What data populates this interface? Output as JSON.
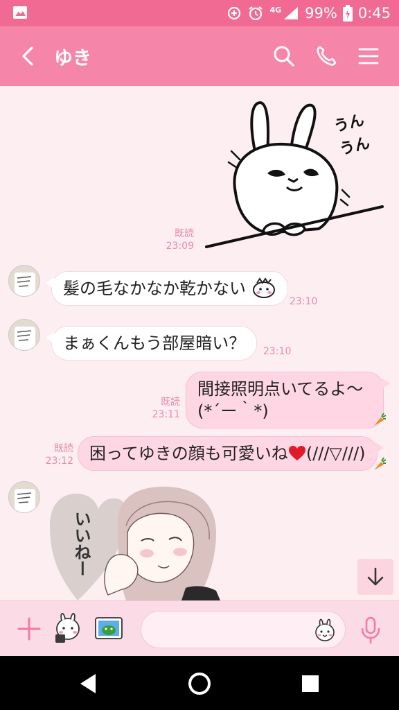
{
  "status_bar": {
    "network": "4G",
    "battery": "99%",
    "time": "0:45"
  },
  "header": {
    "title": "ゆき"
  },
  "messages": [
    {
      "sender": "me",
      "type": "sticker",
      "sticker_text": "うん うん",
      "read": "既読",
      "time": "23:09"
    },
    {
      "sender": "yuki",
      "type": "text",
      "text": "髪の毛なかなか乾かない",
      "time": "23:10"
    },
    {
      "sender": "yuki",
      "type": "text",
      "text": "まぁくんもう部屋暗い？",
      "time": "23:10"
    },
    {
      "sender": "me",
      "type": "text",
      "lines": [
        "間接照明点いてるよ〜",
        "(*´ー｀*)"
      ],
      "read": "既読",
      "time": "23:11"
    },
    {
      "sender": "me",
      "type": "text",
      "text": "困ってゆきの顔も可愛いね",
      "text_after": "(///▽///)",
      "read": "既読",
      "time": "23:12"
    },
    {
      "sender": "yuki",
      "type": "sticker",
      "sticker_text": "いいねー"
    }
  ],
  "input": {
    "placeholder": ""
  },
  "colors": {
    "status_bar": "#f06a94",
    "header": "#f586aa",
    "background": "#fdeef2",
    "outgoing_bubble": "#ffd7e4",
    "incoming_bubble": "#ffffff",
    "meta_text": "#e88aa9"
  },
  "icons": {
    "back": "chevron-left-icon",
    "search": "search-icon",
    "call": "phone-icon",
    "menu": "hamburger-menu-icon",
    "plus": "plus-icon",
    "sticker": "sticker-icon",
    "photo": "photo-icon",
    "emoji": "emoji-icon",
    "mic": "mic-icon",
    "scroll_down": "arrow-down-icon"
  }
}
